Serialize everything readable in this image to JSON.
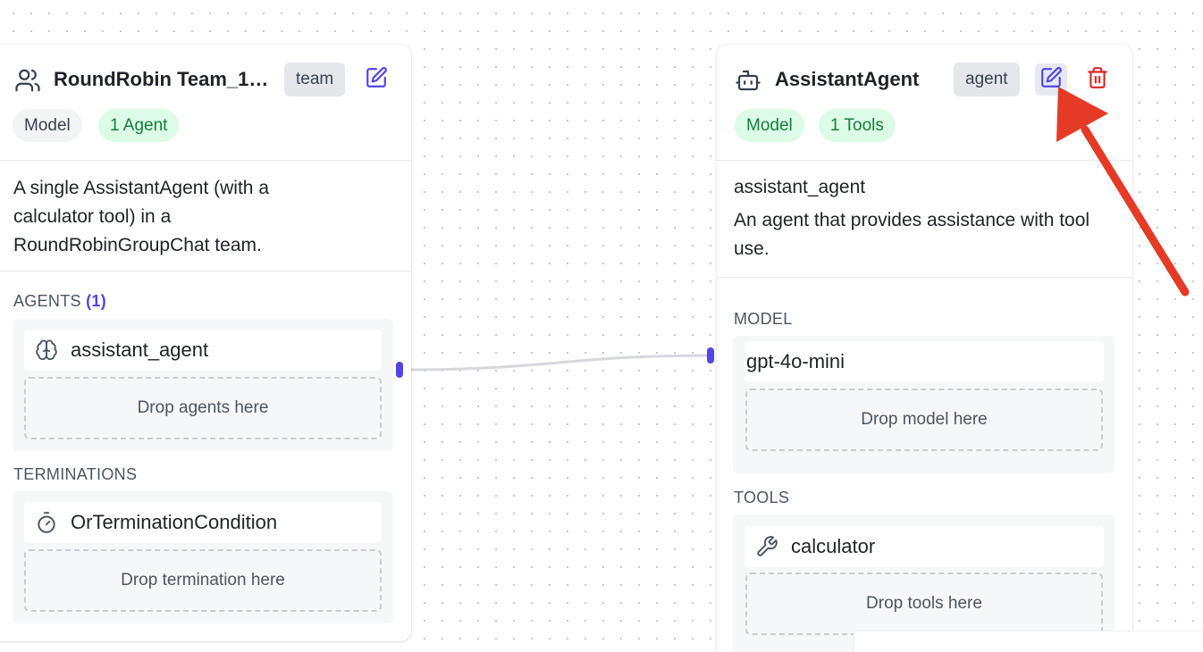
{
  "team_node": {
    "title": "RoundRobin Team_17...",
    "type_badge": "team",
    "pill_model": "Model",
    "pill_agents": "1 Agent",
    "description": "A single AssistantAgent (with a calculator tool) in a RoundRobinGroupChat team.",
    "agents_section": {
      "label": "AGENTS",
      "count": "(1)",
      "item": "assistant_agent",
      "drop_text": "Drop agents here"
    },
    "terminations_section": {
      "label": "TERMINATIONS",
      "item": "OrTerminationCondition",
      "drop_text": "Drop termination here"
    }
  },
  "agent_node": {
    "title": "AssistantAgent",
    "type_badge": "agent",
    "pill_model": "Model",
    "pill_tools": "1 Tools",
    "name": "assistant_agent",
    "description": "An agent that provides assistance with tool use.",
    "model_section": {
      "label": "MODEL",
      "item": "gpt-4o-mini",
      "drop_text": "Drop model here"
    },
    "tools_section": {
      "label": "TOOLS",
      "item": "calculator",
      "drop_text": "Drop tools here"
    }
  },
  "icons": {
    "team": "users-icon",
    "agent": "bot-icon",
    "edit": "edit-icon",
    "delete": "trash-icon",
    "agent_item": "brain-icon",
    "termination_item": "timer-icon",
    "tool_item": "wrench-icon"
  },
  "colors": {
    "accent": "#4f46e5",
    "delete": "#dc2626",
    "pill_green_bg": "#dcfce7",
    "pill_green_text": "#15803d",
    "annotation_arrow": "#e53a25"
  }
}
